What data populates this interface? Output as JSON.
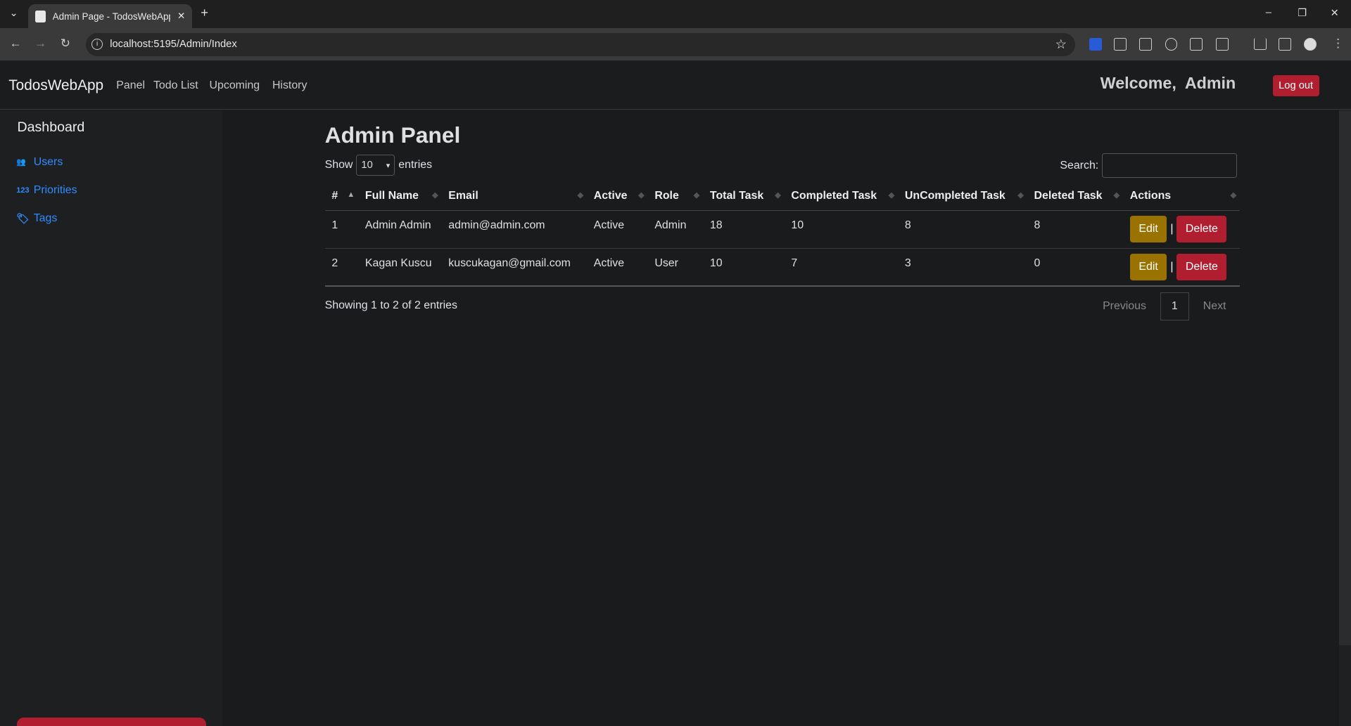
{
  "browser": {
    "tab_title": "Admin Page - TodosWebApp.W",
    "url": "localhost:5195/Admin/Index"
  },
  "navbar": {
    "brand": "TodosWebApp",
    "links": [
      "Panel",
      "Todo List",
      "Upcoming",
      "History"
    ],
    "welcome": "Welcome,",
    "user": "Admin",
    "logout": "Log out"
  },
  "sidebar": {
    "title": "Dashboard",
    "items": [
      {
        "label": "Users",
        "icon": "users-icon"
      },
      {
        "label": "Priorities",
        "icon": "123-icon",
        "icon_text": "123"
      },
      {
        "label": "Tags",
        "icon": "tags-icon"
      }
    ]
  },
  "main": {
    "title": "Admin Panel",
    "show": "Show",
    "entries_value": "10",
    "entries": "entries",
    "search_label": "Search:",
    "columns": [
      "#",
      "Full Name",
      "Email",
      "Active",
      "Role",
      "Total Task",
      "Completed Task",
      "UnCompleted Task",
      "Deleted Task",
      "Actions"
    ],
    "rows": [
      [
        "1",
        "Admin Admin",
        "admin@admin.com",
        "Active",
        "Admin",
        "18",
        "10",
        "8",
        "8"
      ],
      [
        "2",
        "Kagan Kuscu",
        "kuscukagan@gmail.com",
        "Active",
        "User",
        "10",
        "7",
        "3",
        "0"
      ]
    ],
    "edit": "Edit",
    "sep": "|",
    "delete": "Delete",
    "info": "Showing 1 to 2 of 2 entries",
    "previous": "Previous",
    "page": "1",
    "next": "Next"
  },
  "colors": {
    "accent": "#2f8cff",
    "danger": "#b01e2f",
    "warning": "#9a7200"
  }
}
